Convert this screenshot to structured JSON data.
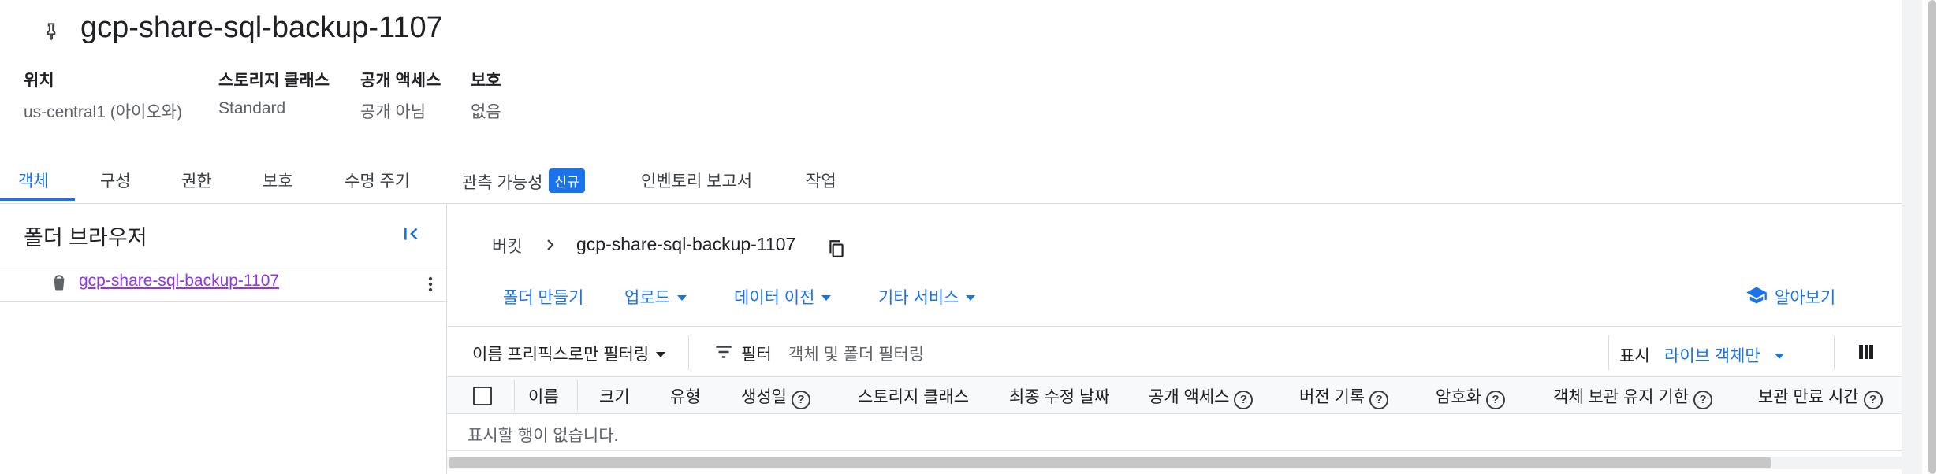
{
  "header": {
    "title": "gcp-share-sql-backup-1107",
    "meta": [
      {
        "label": "위치",
        "value": "us-central1 (아이오와)"
      },
      {
        "label": "스토리지 클래스",
        "value": "Standard"
      },
      {
        "label": "공개 액세스",
        "value": "공개 아님"
      },
      {
        "label": "보호",
        "value": "없음"
      }
    ]
  },
  "tabs": [
    {
      "label": "객체",
      "active": true
    },
    {
      "label": "구성"
    },
    {
      "label": "권한"
    },
    {
      "label": "보호"
    },
    {
      "label": "수명 주기"
    },
    {
      "label": "관측 가능성",
      "badge": "신규"
    },
    {
      "label": "인벤토리 보고서"
    },
    {
      "label": "작업"
    }
  ],
  "folder_browser": {
    "title": "폴더 브라우저",
    "bucket": "gcp-share-sql-backup-1107"
  },
  "breadcrumb": {
    "root": "버킷",
    "current": "gcp-share-sql-backup-1107"
  },
  "toolbar": {
    "create_folder": "폴더 만들기",
    "upload": "업로드",
    "transfer": "데이터 이전",
    "other": "기타 서비스",
    "learn": "알아보기"
  },
  "filter": {
    "prefix_filter": "이름 프리픽스로만 필터링",
    "filter_label": "필터",
    "placeholder": "객체 및 폴더 필터링",
    "show_label": "표시",
    "show_value": "라이브 객체만"
  },
  "table": {
    "columns": [
      "이름",
      "크기",
      "유형",
      "생성일",
      "스토리지 클래스",
      "최종 수정 날짜",
      "공개 액세스",
      "버전 기록",
      "암호화",
      "객체 보관 유지 기한",
      "보관 만료 시간"
    ],
    "empty_message": "표시할 행이 없습니다."
  },
  "colors": {
    "accent": "#1a73e8",
    "visited_link": "#9334e6"
  }
}
